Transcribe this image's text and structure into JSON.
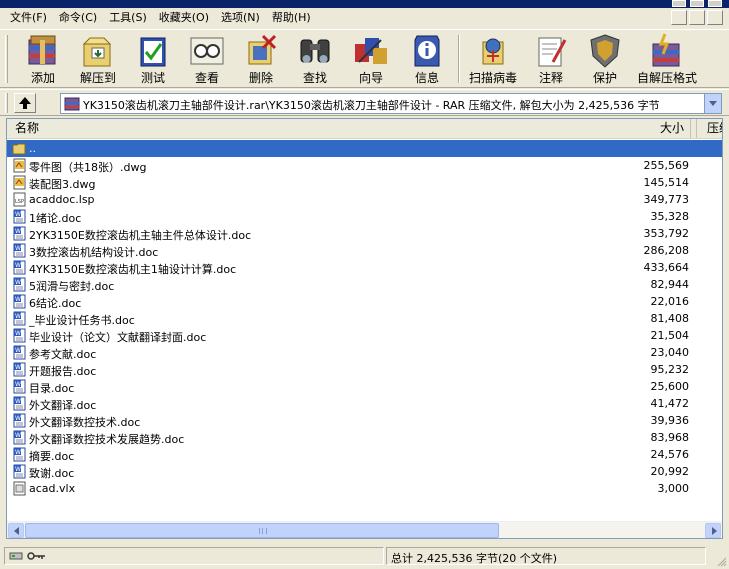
{
  "menubar": {
    "items": [
      "文件(F)",
      "命令(C)",
      "工具(S)",
      "收藏夹(O)",
      "选项(N)",
      "帮助(H)"
    ]
  },
  "toolbar": {
    "buttons": [
      {
        "label": "添加",
        "icon": "add-archive-icon"
      },
      {
        "label": "解压到",
        "icon": "extract-to-icon"
      },
      {
        "label": "测试",
        "icon": "test-icon"
      },
      {
        "label": "查看",
        "icon": "view-icon"
      },
      {
        "label": "删除",
        "icon": "delete-icon"
      },
      {
        "label": "查找",
        "icon": "find-icon"
      },
      {
        "label": "向导",
        "icon": "wizard-icon"
      },
      {
        "label": "信息",
        "icon": "info-icon"
      },
      {
        "label": "扫描病毒",
        "icon": "virus-scan-icon"
      },
      {
        "label": "注释",
        "icon": "comment-icon"
      },
      {
        "label": "保护",
        "icon": "protect-icon"
      },
      {
        "label": "自解压格式",
        "icon": "sfx-icon"
      }
    ]
  },
  "address": {
    "text": "YK3150滚齿机滚刀主轴部件设计.rar\\YK3150滚齿机滚刀主轴部件设计 - RAR 压缩文件, 解包大小为 2,425,536 字节"
  },
  "list": {
    "columns": {
      "name": "名称",
      "size": "大小",
      "packed": "压缩"
    },
    "parent": "..",
    "files": [
      {
        "name": "零件图（共18张）.dwg",
        "size": "255,569",
        "icon": "dwg-file-icon"
      },
      {
        "name": "装配图3.dwg",
        "size": "145,514",
        "icon": "dwg-file-icon"
      },
      {
        "name": "acaddoc.lsp",
        "size": "349,773",
        "icon": "lsp-file-icon"
      },
      {
        "name": "1绪论.doc",
        "size": "35,328",
        "icon": "doc-file-icon"
      },
      {
        "name": "2YK3150E数控滚齿机主轴主件总体设计.doc",
        "size": "353,792",
        "icon": "doc-file-icon"
      },
      {
        "name": "3数控滚齿机结构设计.doc",
        "size": "286,208",
        "icon": "doc-file-icon"
      },
      {
        "name": "4YK3150E数控滚齿机主1轴设计计算.doc",
        "size": "433,664",
        "icon": "doc-file-icon"
      },
      {
        "name": "5润滑与密封.doc",
        "size": "82,944",
        "icon": "doc-file-icon"
      },
      {
        "name": "6结论.doc",
        "size": "22,016",
        "icon": "doc-file-icon"
      },
      {
        "name": "_毕业设计任务书.doc",
        "size": "81,408",
        "icon": "doc-file-icon"
      },
      {
        "name": "毕业设计（论文）文献翻译封面.doc",
        "size": "21,504",
        "icon": "doc-file-icon"
      },
      {
        "name": "参考文献.doc",
        "size": "23,040",
        "icon": "doc-file-icon"
      },
      {
        "name": "开题报告.doc",
        "size": "95,232",
        "icon": "doc-file-icon"
      },
      {
        "name": "目录.doc",
        "size": "25,600",
        "icon": "doc-file-icon"
      },
      {
        "name": "外文翻译.doc",
        "size": "41,472",
        "icon": "doc-file-icon"
      },
      {
        "name": "外文翻译数控技术.doc",
        "size": "39,936",
        "icon": "doc-file-icon"
      },
      {
        "name": "外文翻译数控技术发展趋势.doc",
        "size": "83,968",
        "icon": "doc-file-icon"
      },
      {
        "name": "摘要.doc",
        "size": "24,576",
        "icon": "doc-file-icon"
      },
      {
        "name": "致谢.doc",
        "size": "20,992",
        "icon": "doc-file-icon"
      },
      {
        "name": "acad.vlx",
        "size": "3,000",
        "icon": "vlx-file-icon"
      }
    ]
  },
  "status": {
    "total": "总计 2,425,536 字节(20 个文件)"
  },
  "colors": {
    "selection": "#316ac5",
    "window_bg": "#ece9d8"
  }
}
